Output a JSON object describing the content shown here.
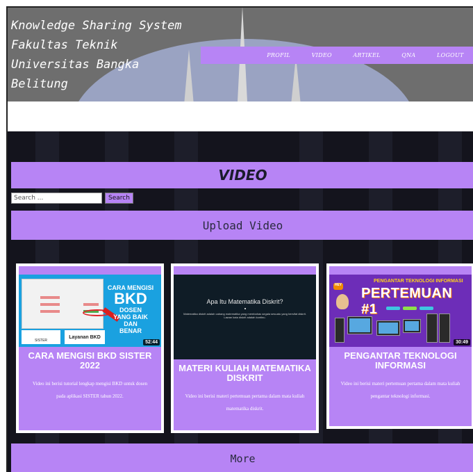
{
  "site": {
    "title_lines": [
      "Knowledge Sharing System",
      "Fakultas Teknik",
      "Universitas Bangka",
      "Belitung"
    ]
  },
  "nav": {
    "items": [
      {
        "label": "PROFIL"
      },
      {
        "label": "VIDEO"
      },
      {
        "label": "ARTIKEL"
      },
      {
        "label": "QNA"
      },
      {
        "label": "LOGOUT"
      }
    ]
  },
  "page": {
    "section_title": "VIDEO",
    "upload_label": "Upload Video",
    "more_label": "More"
  },
  "search": {
    "placeholder": "Search ...",
    "button_label": "Search"
  },
  "videos": [
    {
      "title": "CARA MENGISI BKD SISTER 2022",
      "description": "Video ini berisi tutorial lengkap mengisi BKD untuk dosen pada aplikasi SISTER tahun 2022.",
      "duration": "52:44",
      "thumb": {
        "line1": "CARA MENGISI",
        "line2": "BKD",
        "line3": "DOSEN",
        "line4": "YANG BAIK",
        "line5": "DAN",
        "line6": "BENAR",
        "badge_left": "SISTER",
        "badge_right": "Layanan BKD"
      }
    },
    {
      "title": "MATERI KULIAH MATEMATIKA DISKRIT",
      "description": "Video ini berisi materi pertemuan pertama dalam mata kuliah matematika diskrit.",
      "duration": "",
      "thumb": {
        "question": "Apa Itu Matematika Diskrit?",
        "text": "Matematika diskrit adalah cabang matematika yang membahas segala sesuatu yang bersifat diskrit. Lawan kata diskrit adalah kontinu."
      }
    },
    {
      "title": "PENGANTAR TEKNOLOGI INFORMASI",
      "description": "Video ini berisi materi pertemuan pertama dalam mata kuliah pengantar teknologi informasi.",
      "duration": "30:49",
      "thumb": {
        "small": "PENGANTAR TEKNOLOGI INFORMASI",
        "big": "PERTEMUAN #1",
        "hey": "HEY"
      }
    }
  ],
  "colors": {
    "accent": "#b784f5",
    "background_dark": "#14141d",
    "header_gray": "#6e6e6e"
  }
}
